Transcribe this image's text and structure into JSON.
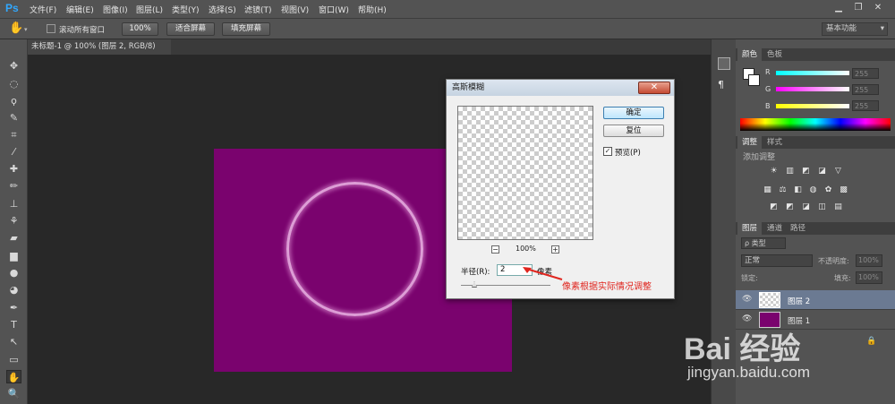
{
  "app": {
    "logo": "Ps"
  },
  "menu": [
    "文件(F)",
    "编辑(E)",
    "图像(I)",
    "图层(L)",
    "类型(Y)",
    "选择(S)",
    "滤镜(T)",
    "视图(V)",
    "窗口(W)",
    "帮助(H)"
  ],
  "window_controls": {
    "minimize": "▁",
    "restore": "❐",
    "close": "✕"
  },
  "options": {
    "scroll_all": "滚动所有窗口",
    "zoom": "100%",
    "fit_screen": "适合屏幕",
    "fill_screen": "填充屏幕",
    "workspace": "基本功能"
  },
  "document": {
    "tab": "未标题-1 @ 100% (图层 2, RGB/8) *",
    "tab_close": "×",
    "canvas_color": "#7a036e"
  },
  "color_panel": {
    "tab_color": "颜色",
    "tab_swatches": "色板",
    "r_label": "R",
    "g_label": "G",
    "b_label": "B",
    "r": "255",
    "g": "255",
    "b": "255"
  },
  "adjust_panel": {
    "tab_adjust": "调整",
    "tab_styles": "样式",
    "add_adjust": "添加调整"
  },
  "layers_panel": {
    "tab_layers": "图层",
    "tab_channels": "通道",
    "tab_paths": "路径",
    "filter_kind": "ρ 类型",
    "blend_mode": "正常",
    "opacity_label": "不透明度:",
    "opacity": "100%",
    "lock_label": "锁定:",
    "fill_label": "填充:",
    "fill": "100%",
    "layers": [
      {
        "name": "图层 2",
        "selected": true
      },
      {
        "name": "图层 1",
        "selected": false
      }
    ]
  },
  "dialog": {
    "title": "高斯模糊",
    "close": "✕",
    "ok": "确定",
    "reset": "复位",
    "preview_label": "预览(P)",
    "preview_checked": true,
    "zoom": "100%",
    "zoom_out": "−",
    "zoom_in": "+",
    "radius_label": "半径(R):",
    "radius": "2",
    "unit": "像素"
  },
  "annotation": {
    "text": "像素根据实际情况调整",
    "color": "#e0261f"
  },
  "watermark": {
    "text": "Bai 经验",
    "url": "jingyan.baidu.com"
  }
}
